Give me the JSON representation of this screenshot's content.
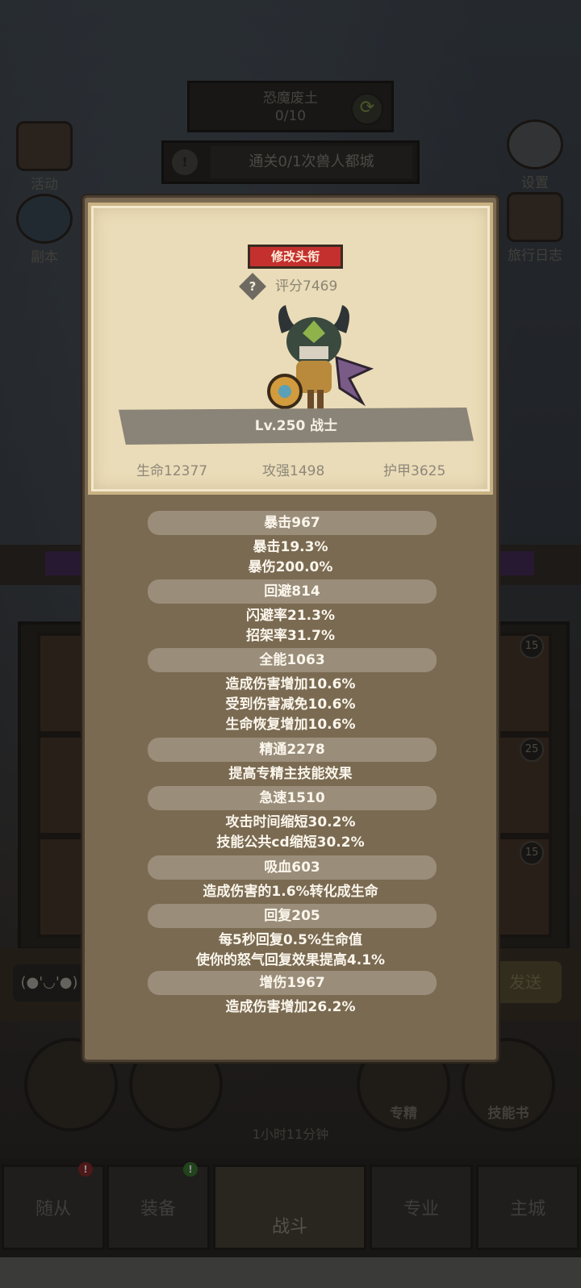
{
  "background": {
    "quest": {
      "title": "恐魔废土",
      "progress": "0/10"
    },
    "task_text": "通关0/1次兽人都城",
    "side_left": [
      "活动",
      "副本"
    ],
    "side_right": [
      "设置",
      "旅行日志"
    ],
    "grid_badges": [
      "15",
      "25",
      "15"
    ],
    "chat": {
      "emoticon": "(●'◡'●)",
      "send": "发送"
    },
    "actions": {
      "specialty": "专精",
      "skill_book": "技能书"
    },
    "chest_timer": "1小时11分钟",
    "nav": {
      "followers": "随从",
      "equipment": "装备",
      "battle": "战斗",
      "profession": "专业",
      "main_city": "主城",
      "followers_badge": "!",
      "equipment_badge": "!"
    }
  },
  "popup": {
    "edit_title_label": "修改头衔",
    "help_glyph": "?",
    "score": "评分7469",
    "level_class": "Lv.250 战士",
    "stats": {
      "hp": "生命12377",
      "attack": "攻强1498",
      "armor": "护甲3625"
    },
    "attributes": [
      {
        "header": "暴击967",
        "lines": [
          "暴击19.3%",
          "暴伤200.0%"
        ]
      },
      {
        "header": "回避814",
        "lines": [
          "闪避率21.3%",
          "招架率31.7%"
        ]
      },
      {
        "header": "全能1063",
        "lines": [
          "造成伤害增加10.6%",
          "受到伤害减免10.6%",
          "生命恢复增加10.6%"
        ]
      },
      {
        "header": "精通2278",
        "lines": [
          "提高专精主技能效果"
        ]
      },
      {
        "header": "急速1510",
        "lines": [
          "攻击时间缩短30.2%",
          "技能公共cd缩短30.2%"
        ]
      },
      {
        "header": "吸血603",
        "lines": [
          "造成伤害的1.6%转化成生命"
        ]
      },
      {
        "header": "回复205",
        "lines": [
          "每5秒回复0.5%生命值",
          "使你的怒气回复效果提高4.1%"
        ]
      },
      {
        "header": "增伤1967",
        "lines": [
          "造成伤害增加26.2%"
        ]
      }
    ]
  }
}
